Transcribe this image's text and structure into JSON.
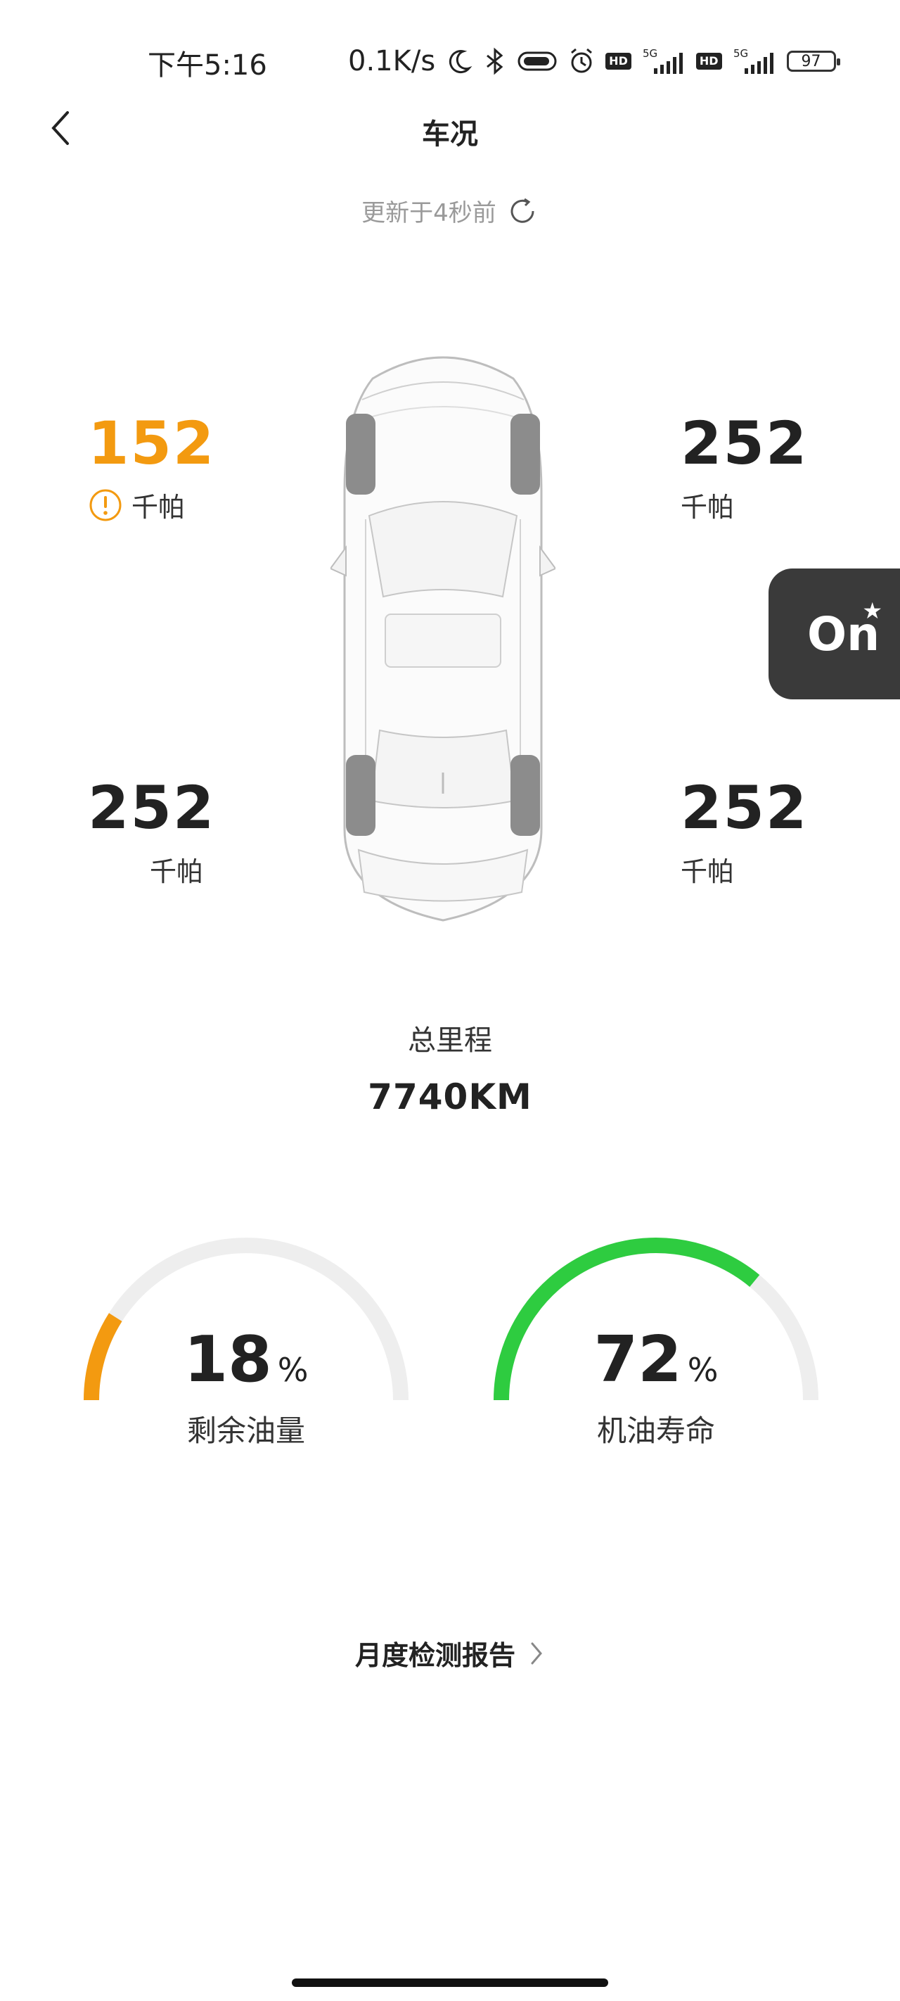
{
  "status_bar": {
    "time": "下午5:16",
    "network_speed": "0.1K/s",
    "hd1": "HD",
    "net1": "5G",
    "hd2": "HD",
    "net2": "5G",
    "battery": "97",
    "icons": [
      "moon-icon",
      "bluetooth-icon",
      "toggle-icon",
      "alarm-icon",
      "signal-icon",
      "battery-icon"
    ]
  },
  "header": {
    "title": "车况"
  },
  "update": {
    "text": "更新于4秒前"
  },
  "tires": {
    "front_left": {
      "value": "152",
      "unit": "千帕",
      "warning": true
    },
    "front_right": {
      "value": "252",
      "unit": "千帕",
      "warning": false
    },
    "rear_left": {
      "value": "252",
      "unit": "千帕",
      "warning": false
    },
    "rear_right": {
      "value": "252",
      "unit": "千帕",
      "warning": false
    }
  },
  "on_button": {
    "label": "On",
    "star": "★"
  },
  "mileage": {
    "label": "总里程",
    "value": "7740KM"
  },
  "gauges": {
    "fuel": {
      "value": "18",
      "unit": "%",
      "label": "剩余油量",
      "fraction": 0.18,
      "color": "#f39a10"
    },
    "oil": {
      "value": "72",
      "unit": "%",
      "label": "机油寿命",
      "fraction": 0.72,
      "color": "#2ecc40"
    }
  },
  "report": {
    "label": "月度检测报告"
  },
  "colors": {
    "warning": "#f39a10",
    "good": "#2ecc40",
    "track": "#eeeeee",
    "on_button_bg": "#3a3a3a"
  }
}
